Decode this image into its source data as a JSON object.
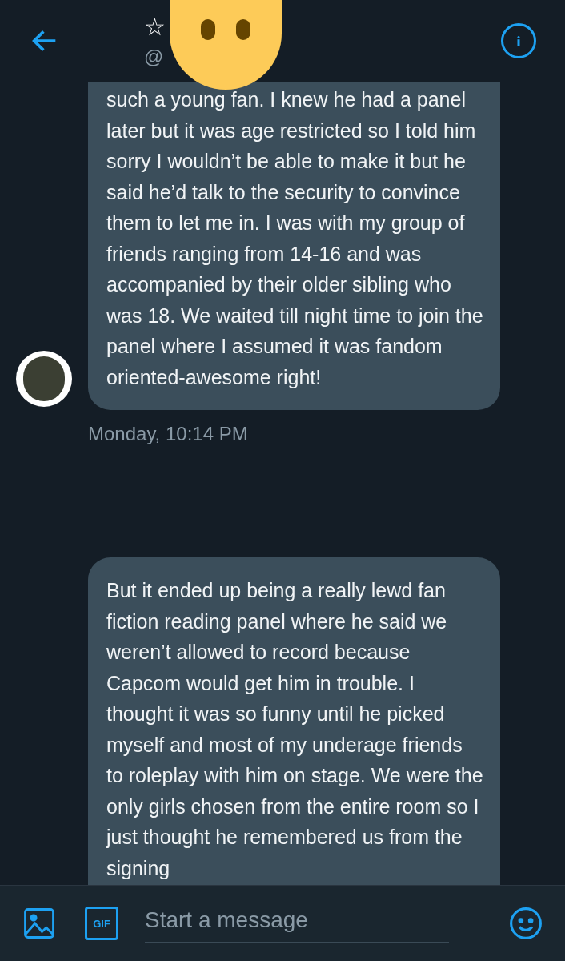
{
  "header": {
    "title": "☆",
    "handle": "@"
  },
  "messages": [
    {
      "text": "such a young fan. I knew he had a panel later but it was age restricted so I told him sorry I wouldn’t be able to make it but he said he’d talk to the security to convince them to let me in. I was with my group of friends ranging from 14-16 and was accompanied by their older sibling who was 18. We waited till night time to join the panel where I assumed it was fandom oriented-awesome right!",
      "time": "Monday, 10:14 PM",
      "avatar": true
    },
    {
      "text": "But it ended up being a really lewd fan fiction reading panel where he said we weren’t allowed to record because Capcom would get him in trouble. I thought it was so funny until he picked myself and most of my underage friends to roleplay with him on stage. We were the only girls chosen from the entire room so I just thought he remembered us from the signing",
      "avatar": false
    }
  ],
  "composer": {
    "gif_label": "GIF",
    "placeholder": "Start a message"
  }
}
